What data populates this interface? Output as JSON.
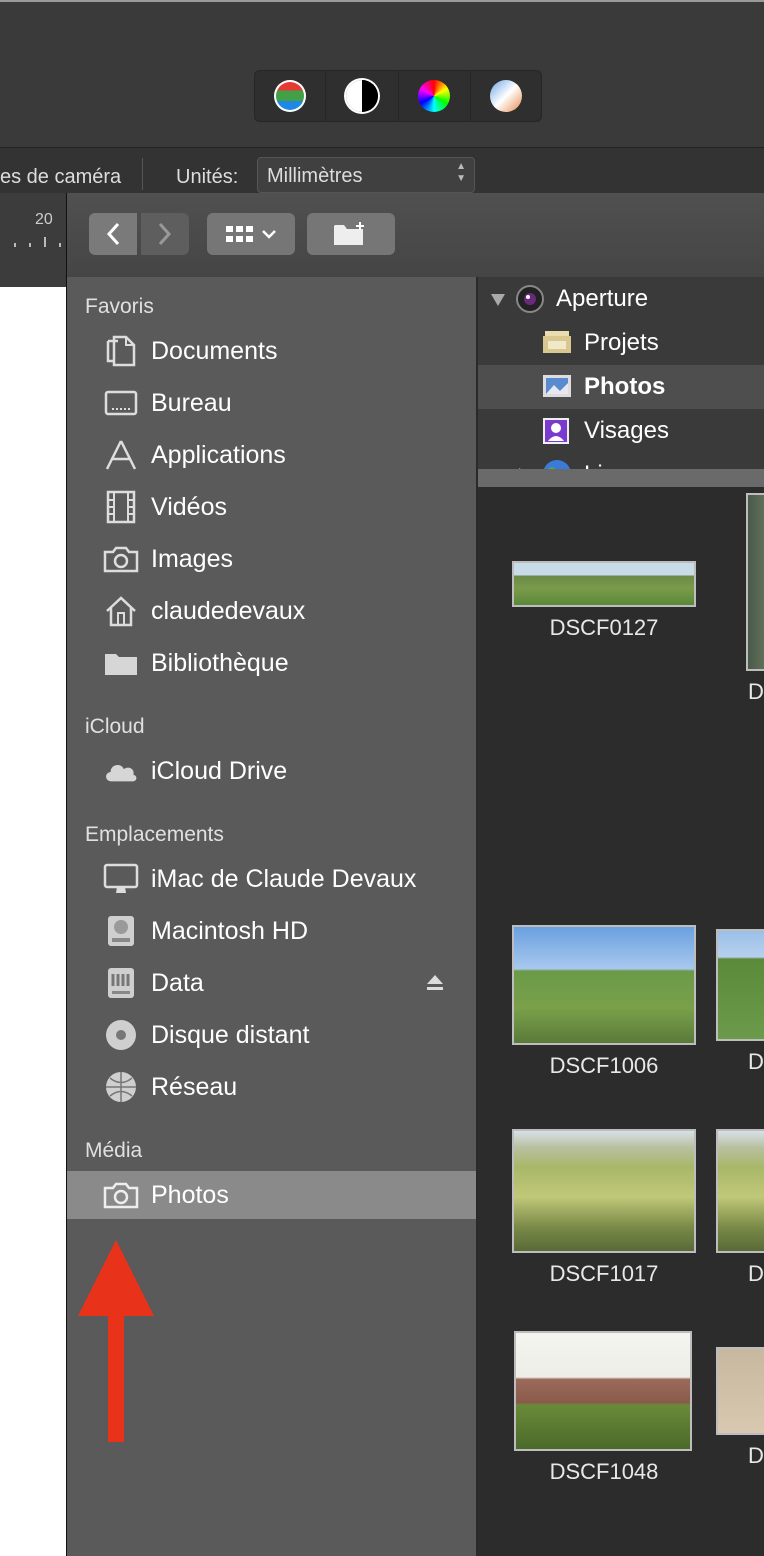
{
  "toolbar": {
    "adjust_tools": [
      {
        "name": "levels-icon",
        "color": "#e53935"
      },
      {
        "name": "contrast-icon",
        "color": "#ffffff"
      },
      {
        "name": "color-wheel-icon",
        "color": "#ff00ff"
      },
      {
        "name": "white-balance-icon",
        "color": "#e88a4a"
      }
    ]
  },
  "options": {
    "camera_label": "es de caméra",
    "units_label": "Unités:",
    "units_value": "Millimètres"
  },
  "ruler": {
    "label": "20"
  },
  "dialog": {
    "sidebar": {
      "favoris_title": "Favoris",
      "favoris": [
        {
          "label": "Documents",
          "icon": "documents-icon"
        },
        {
          "label": "Bureau",
          "icon": "desktop-icon"
        },
        {
          "label": "Applications",
          "icon": "applications-icon"
        },
        {
          "label": "Vidéos",
          "icon": "movies-icon"
        },
        {
          "label": "Images",
          "icon": "camera-icon"
        },
        {
          "label": "claudedevaux",
          "icon": "home-icon"
        },
        {
          "label": "Bibliothèque",
          "icon": "folder-icon"
        }
      ],
      "icloud_title": "iCloud",
      "icloud": [
        {
          "label": "iCloud Drive",
          "icon": "cloud-icon"
        }
      ],
      "emplacements_title": "Emplacements",
      "emplacements": [
        {
          "label": "iMac de Claude Devaux",
          "icon": "imac-icon"
        },
        {
          "label": "Macintosh HD",
          "icon": "hard-drive-icon"
        },
        {
          "label": "Data",
          "icon": "users-drive-icon"
        },
        {
          "label": "Disque distant",
          "icon": "disc-icon"
        },
        {
          "label": "Réseau",
          "icon": "network-icon"
        }
      ],
      "media_title": "Média",
      "media": [
        {
          "label": "Photos",
          "icon": "camera-icon",
          "selected": true
        }
      ]
    },
    "tree": [
      {
        "label": "Aperture",
        "icon": "aperture-icon"
      },
      {
        "label": "Projets",
        "icon": "projects-icon"
      },
      {
        "label": "Photos",
        "icon": "photos-icon",
        "selected": true
      },
      {
        "label": "Visages",
        "icon": "faces-icon"
      },
      {
        "label": "Lieux",
        "icon": "globe-icon"
      }
    ],
    "thumbnails": [
      {
        "name": "DSCF0127"
      },
      {
        "name": "D"
      },
      {
        "name": "DSCF1006"
      },
      {
        "name": "D"
      },
      {
        "name": "DSCF1017"
      },
      {
        "name": "D"
      },
      {
        "name": "DSCF1048"
      },
      {
        "name": "D"
      }
    ]
  },
  "annotation": {
    "arrow_color": "#e8321a"
  }
}
